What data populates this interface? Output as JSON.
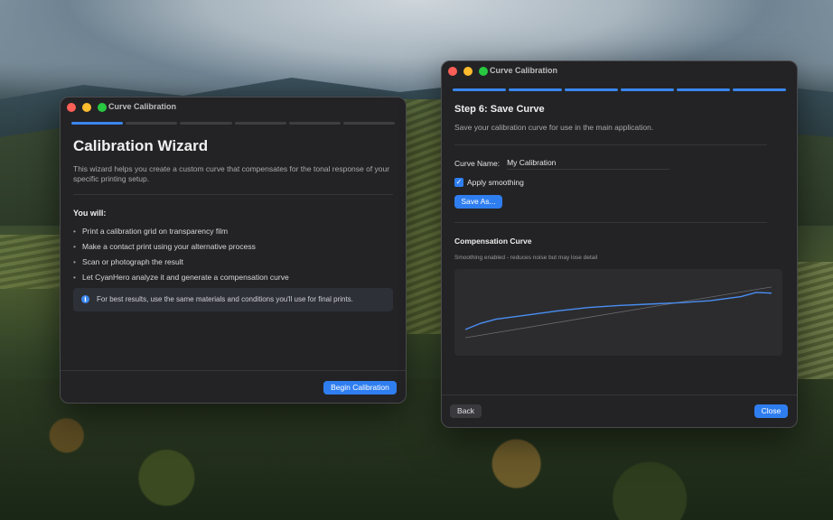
{
  "left_window": {
    "title": "Curve Calibration",
    "progress": {
      "total_steps": 6,
      "current_step": 1
    },
    "heading": "Calibration Wizard",
    "description": "This wizard helps you create a custom curve that compensates for the tonal response of your specific printing setup.",
    "you_will_label": "You will:",
    "steps": [
      "Print a calibration grid on transparency film",
      "Make a contact print using your alternative process",
      "Scan or photograph the result",
      "Let CyanHero analyze it and generate a compensation curve"
    ],
    "info_text": "For best results, use the same materials and conditions you'll use for final prints.",
    "begin_button": "Begin Calibration"
  },
  "right_window": {
    "title": "Curve Calibration",
    "progress": {
      "total_steps": 6,
      "current_step": 6
    },
    "step_heading": "Step 6: Save Curve",
    "step_description": "Save your calibration curve for use in the main application.",
    "curve_name_label": "Curve Name:",
    "curve_name_value": "My Calibration",
    "apply_smoothing_label": "Apply smoothing",
    "apply_smoothing_checked": true,
    "save_as_button": "Save As...",
    "compensation_heading": "Compensation Curve",
    "smoothing_note": "Smoothing enabled - reduces noise but may lose detail",
    "back_button": "Back",
    "close_button": "Close"
  },
  "colors": {
    "accent": "#2f7ef0",
    "curve": "#4a8ef2",
    "window_bg": "#232325",
    "chart_bg": "#2c2c2f"
  },
  "chart_data": {
    "type": "line",
    "title": "",
    "xlabel": "",
    "ylabel": "",
    "xlim": [
      0,
      1
    ],
    "ylim": [
      0,
      1
    ],
    "grid": false,
    "series": [
      {
        "x": [
          0,
          0.05,
          0.1,
          0.2,
          0.3,
          0.4,
          0.5,
          0.6,
          0.7,
          0.8,
          0.9,
          0.95,
          1.0
        ],
        "y": [
          0.25,
          0.34,
          0.4,
          0.46,
          0.52,
          0.57,
          0.6,
          0.62,
          0.64,
          0.67,
          0.73,
          0.79,
          0.78
        ],
        "color": "#4a8ef2"
      },
      {
        "x": [
          0,
          1
        ],
        "y": [
          0.13,
          0.87
        ],
        "color": "#6a6a70"
      }
    ]
  }
}
